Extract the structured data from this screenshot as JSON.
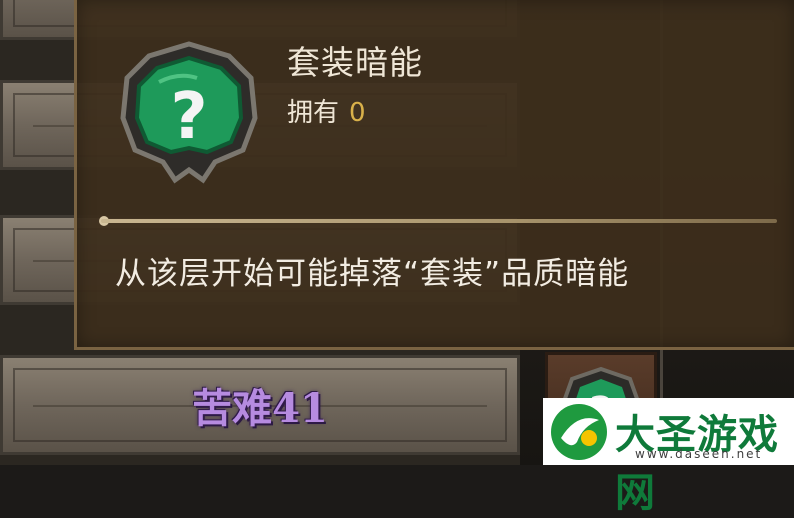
{
  "popup": {
    "title": "套装暗能",
    "owned_label": "拥有",
    "owned_count": "0",
    "description": "从该层开始可能掉落“套装”品质暗能"
  },
  "floors": [
    {
      "label": ""
    },
    {
      "label": ""
    },
    {
      "label": ""
    },
    {
      "label": "苦难41"
    }
  ],
  "emblem": {
    "icon": "question-gem-icon",
    "gem_color": "#1e9a5a"
  },
  "watermark": {
    "brand": "大圣游戏网",
    "url": "www.daseen.net"
  },
  "colors": {
    "owned_count": "#d9b14a",
    "floor_label": "#b68be0"
  }
}
